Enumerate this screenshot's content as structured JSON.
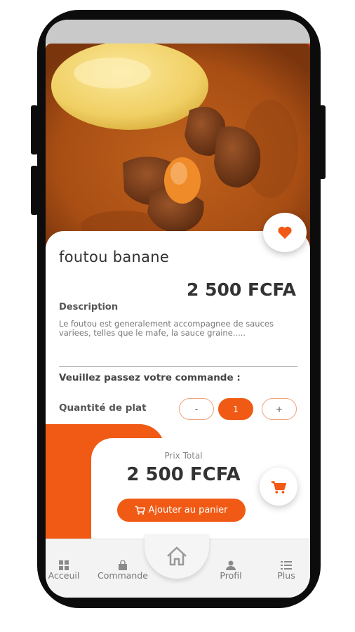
{
  "product": {
    "name": "foutou banane",
    "price": "2 500 FCFA",
    "description_heading": "Description",
    "description": "Le foutou est generalement accompagnee de sauces variees, telles que le mafe, la sauce graine....."
  },
  "order": {
    "heading": "Veuillez passez votre commande :",
    "quantity_label": "Quantité de plat",
    "decrement": "-",
    "quantity": "1",
    "increment": "+"
  },
  "total": {
    "label": "Prix Total",
    "value": "2 500 FCFA",
    "add_to_cart": "Ajouter au panier"
  },
  "nav": {
    "items": [
      {
        "label": "Acceuil",
        "icon": "grid-icon"
      },
      {
        "label": "Commande",
        "icon": "bag-icon"
      },
      {
        "label": "",
        "icon": "home-icon"
      },
      {
        "label": "Profil",
        "icon": "user-icon"
      },
      {
        "label": "Plus",
        "icon": "list-icon"
      }
    ]
  },
  "colors": {
    "accent": "#f05a14",
    "text_dark": "#333333",
    "phone_frame": "#0c0c0c"
  }
}
